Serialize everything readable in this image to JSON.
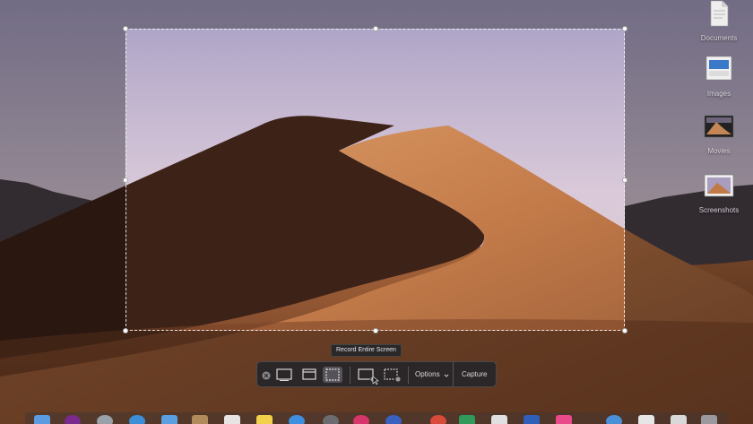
{
  "desktop_icons": [
    {
      "label": "Documents",
      "icon": "document-icon"
    },
    {
      "label": "Images",
      "icon": "images-folder-icon"
    },
    {
      "label": "Movies",
      "icon": "movies-folder-icon"
    },
    {
      "label": "Screenshots",
      "icon": "screenshots-folder-icon"
    }
  ],
  "tooltip": "Record Entire Screen",
  "toolbar": {
    "options_label": "Options",
    "capture_label": "Capture"
  }
}
